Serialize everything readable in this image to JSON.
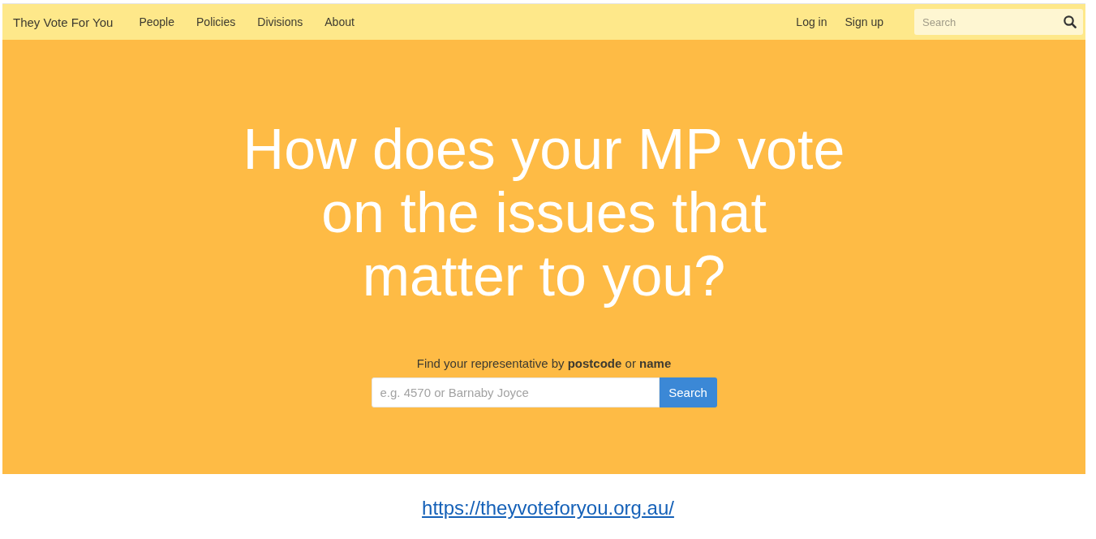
{
  "nav": {
    "brand": "They Vote For You",
    "links": [
      "People",
      "Policies",
      "Divisions",
      "About"
    ],
    "account_links": [
      "Log in",
      "Sign up"
    ],
    "search": {
      "placeholder": "Search"
    }
  },
  "hero": {
    "heading": "How does your MP vote on the issues that matter to you?",
    "prompt": "Find your representative by **postcode** or **name**",
    "search": {
      "placeholder": "e.g. 4570 or Barnaby Joyce",
      "button": "Search"
    }
  },
  "caption_link": "https://theyvoteforyou.org.au/"
}
